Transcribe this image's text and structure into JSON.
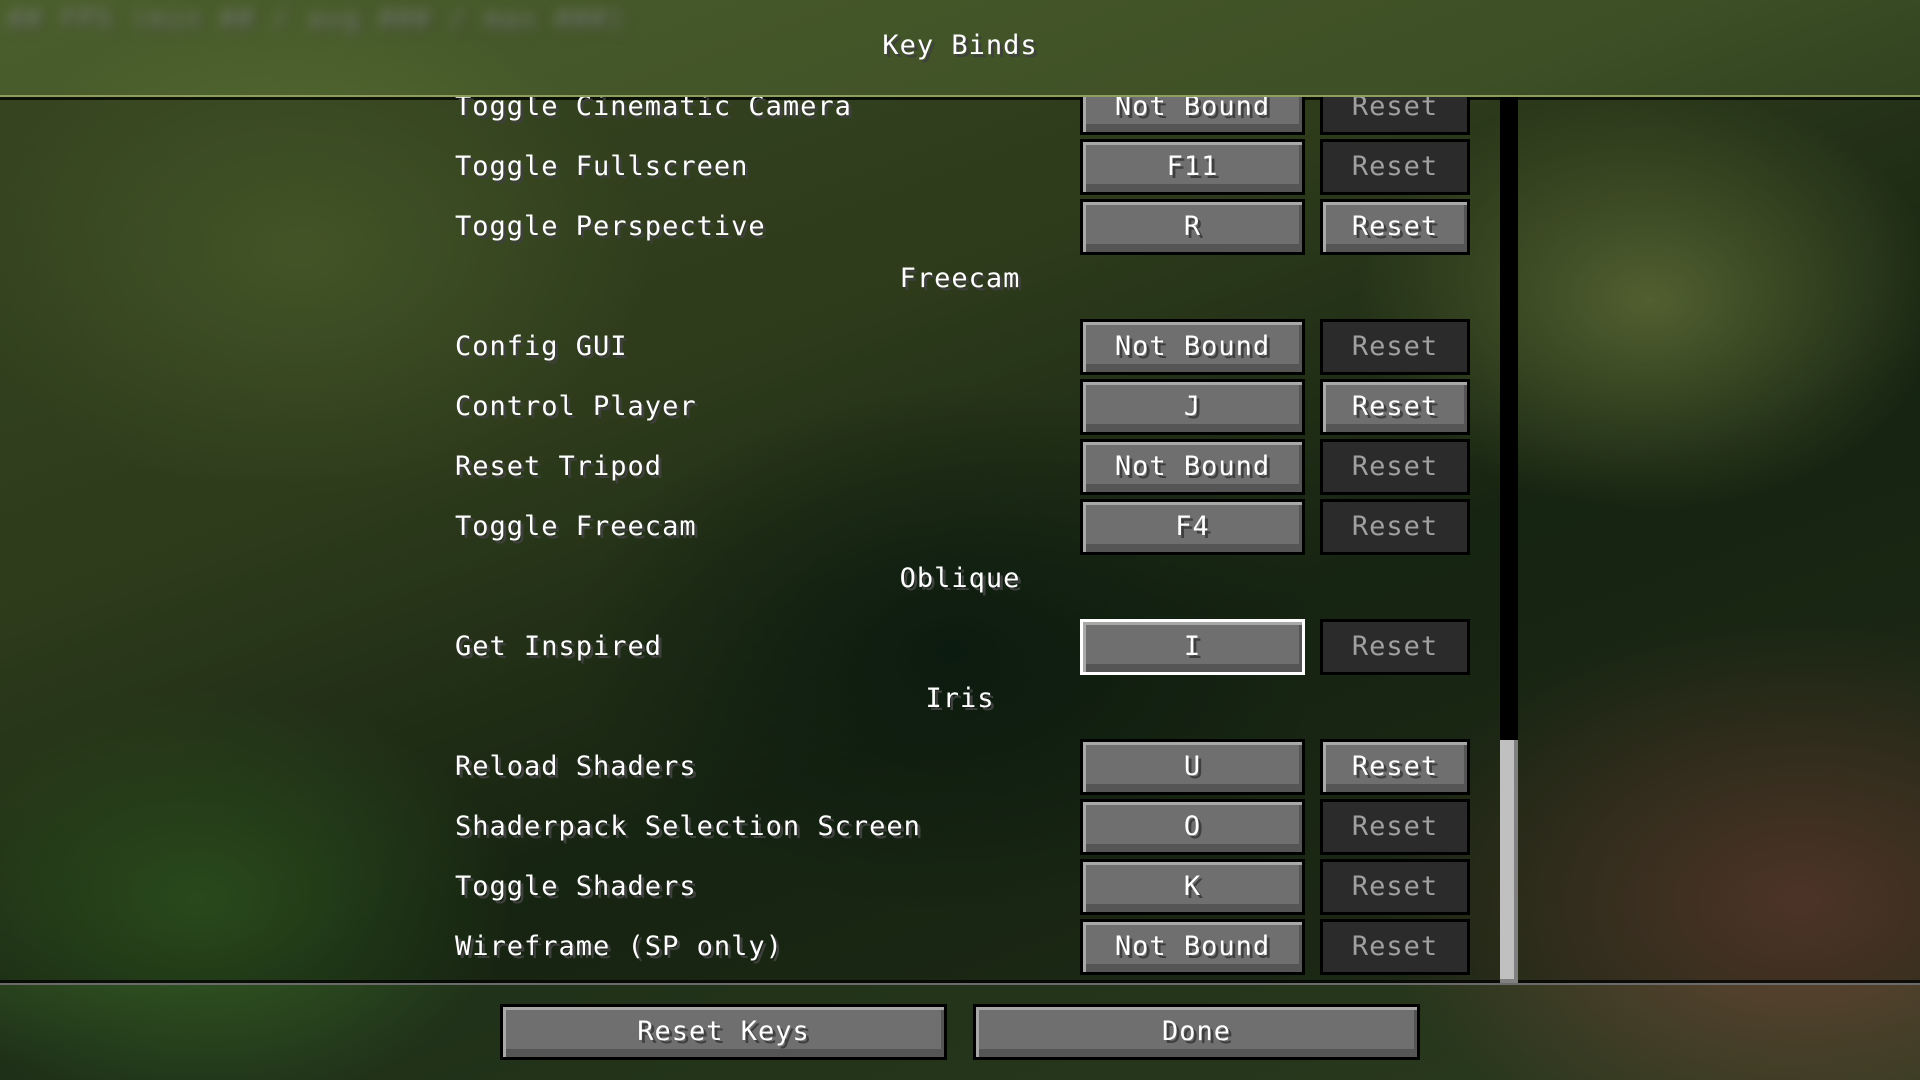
{
  "screen": {
    "title": "Key Binds",
    "debug_overlay": "## FPS (min ## / avg ### / max ###)"
  },
  "rows": [
    {
      "type": "bind",
      "label": "Toggle Cinematic Camera",
      "key": "Not Bound",
      "reset": "Reset",
      "reset_enabled": false,
      "focused": false
    },
    {
      "type": "bind",
      "label": "Toggle Fullscreen",
      "key": "F11",
      "reset": "Reset",
      "reset_enabled": false,
      "focused": false
    },
    {
      "type": "bind",
      "label": "Toggle Perspective",
      "key": "R",
      "reset": "Reset",
      "reset_enabled": true,
      "focused": false
    },
    {
      "type": "category",
      "label": "Freecam"
    },
    {
      "type": "bind",
      "label": "Config GUI",
      "key": "Not Bound",
      "reset": "Reset",
      "reset_enabled": false,
      "focused": false
    },
    {
      "type": "bind",
      "label": "Control Player",
      "key": "J",
      "reset": "Reset",
      "reset_enabled": true,
      "focused": false
    },
    {
      "type": "bind",
      "label": "Reset Tripod",
      "key": "Not Bound",
      "reset": "Reset",
      "reset_enabled": false,
      "focused": false
    },
    {
      "type": "bind",
      "label": "Toggle Freecam",
      "key": "F4",
      "reset": "Reset",
      "reset_enabled": false,
      "focused": false
    },
    {
      "type": "category",
      "label": "Oblique"
    },
    {
      "type": "bind",
      "label": "Get Inspired",
      "key": "I",
      "reset": "Reset",
      "reset_enabled": false,
      "focused": true
    },
    {
      "type": "category",
      "label": "Iris"
    },
    {
      "type": "bind",
      "label": "Reload Shaders",
      "key": "U",
      "reset": "Reset",
      "reset_enabled": true,
      "focused": false
    },
    {
      "type": "bind",
      "label": "Shaderpack Selection Screen",
      "key": "O",
      "reset": "Reset",
      "reset_enabled": false,
      "focused": false
    },
    {
      "type": "bind",
      "label": "Toggle Shaders",
      "key": "K",
      "reset": "Reset",
      "reset_enabled": false,
      "focused": false
    },
    {
      "type": "bind",
      "label": "Wireframe (SP only)",
      "key": "Not Bound",
      "reset": "Reset",
      "reset_enabled": false,
      "focused": false
    }
  ],
  "scroll": {
    "position_fraction": 1.0
  },
  "footer": {
    "reset_keys_label": "Reset Keys",
    "done_label": "Done"
  }
}
